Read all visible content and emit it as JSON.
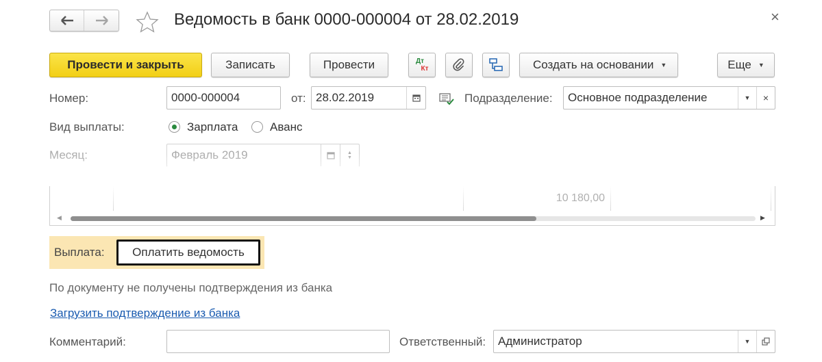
{
  "window": {
    "title": "Ведомость в банк 0000-000004 от 28.02.2019",
    "close_glyph": "×",
    "nav_back": "back-arrow-icon",
    "nav_forward": "forward-arrow-icon",
    "favorite": "star-icon"
  },
  "toolbar": {
    "post_and_close": "Провести и закрыть",
    "save": "Записать",
    "post": "Провести",
    "dtkt_top": "Дт",
    "dtkt_bottom": "Кт",
    "create_based_on": "Создать на основании",
    "more": "Еще",
    "accent_color": "#f7d82a"
  },
  "form": {
    "number_label": "Номер:",
    "number_value": "0000-000004",
    "date_label": "от:",
    "date_value": "28.02.2019",
    "division_label": "Подразделение:",
    "division_value": "Основное подразделение",
    "payment_type_label": "Вид выплаты:",
    "payment_type_options": [
      "Зарплата",
      "Аванс"
    ],
    "payment_type_selected": "Зарплата",
    "month_label": "Месяц:",
    "month_value": "Февраль 2019"
  },
  "table": {
    "total_value": "10 180,00",
    "scroll_fraction_visible": 0.68
  },
  "payment": {
    "label": "Выплата:",
    "button": "Оплатить ведомость",
    "highlight_color": "#fbe6b3"
  },
  "bank": {
    "status_text": "По документу не получены подтверждения из банка",
    "load_link": "Загрузить подтверждение из банка",
    "link_color": "#1a5bb0"
  },
  "footer": {
    "comment_label": "Комментарий:",
    "comment_value": "",
    "responsible_label": "Ответственный:",
    "responsible_value": "Администратор"
  }
}
